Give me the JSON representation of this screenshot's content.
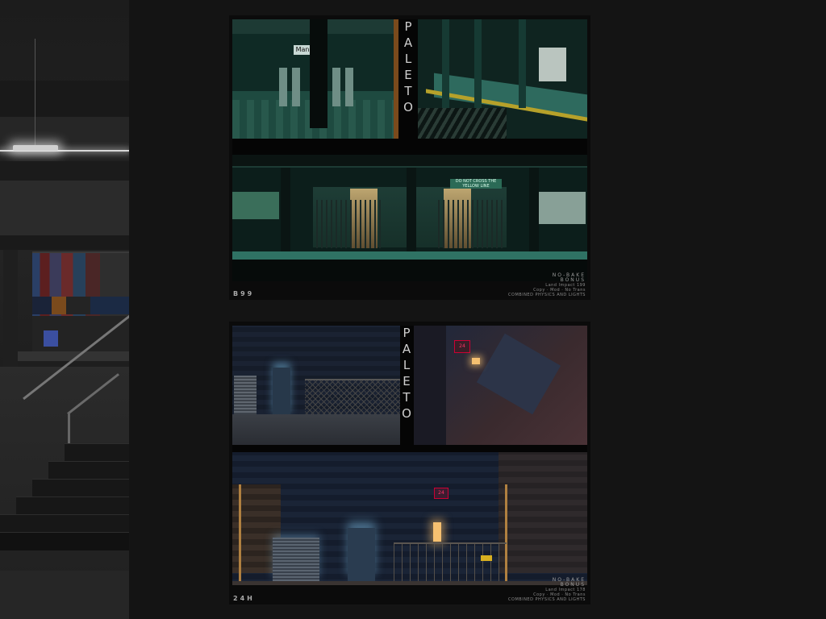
{
  "gallery": {
    "cards": [
      {
        "brand_letters": [
          "P",
          "A",
          "L",
          "E",
          "T",
          "O"
        ],
        "caption": "B99",
        "tag": {
          "line1": "NO-BAKE",
          "line2": "BONUS",
          "line3": "Land Impact 199",
          "line4": "Copy · Mod · No Trans",
          "line5": "COMBINED PHYSICS AND LIGHTS"
        },
        "scene_sign": "Man",
        "scene_label": "DO NOT CROSS THE YELLOW LINE"
      },
      {
        "brand_letters": [
          "P",
          "A",
          "L",
          "E",
          "T",
          "O"
        ],
        "caption": "24H",
        "tag": {
          "line1": "NO-BAKE",
          "line2": "BONUS",
          "line3": "Land Impact 178",
          "line4": "Copy · Mod · No Trans",
          "line5": "COMBINED PHYSICS AND LIGHTS"
        },
        "neon_top": "24",
        "neon_bottom": "24"
      }
    ]
  }
}
